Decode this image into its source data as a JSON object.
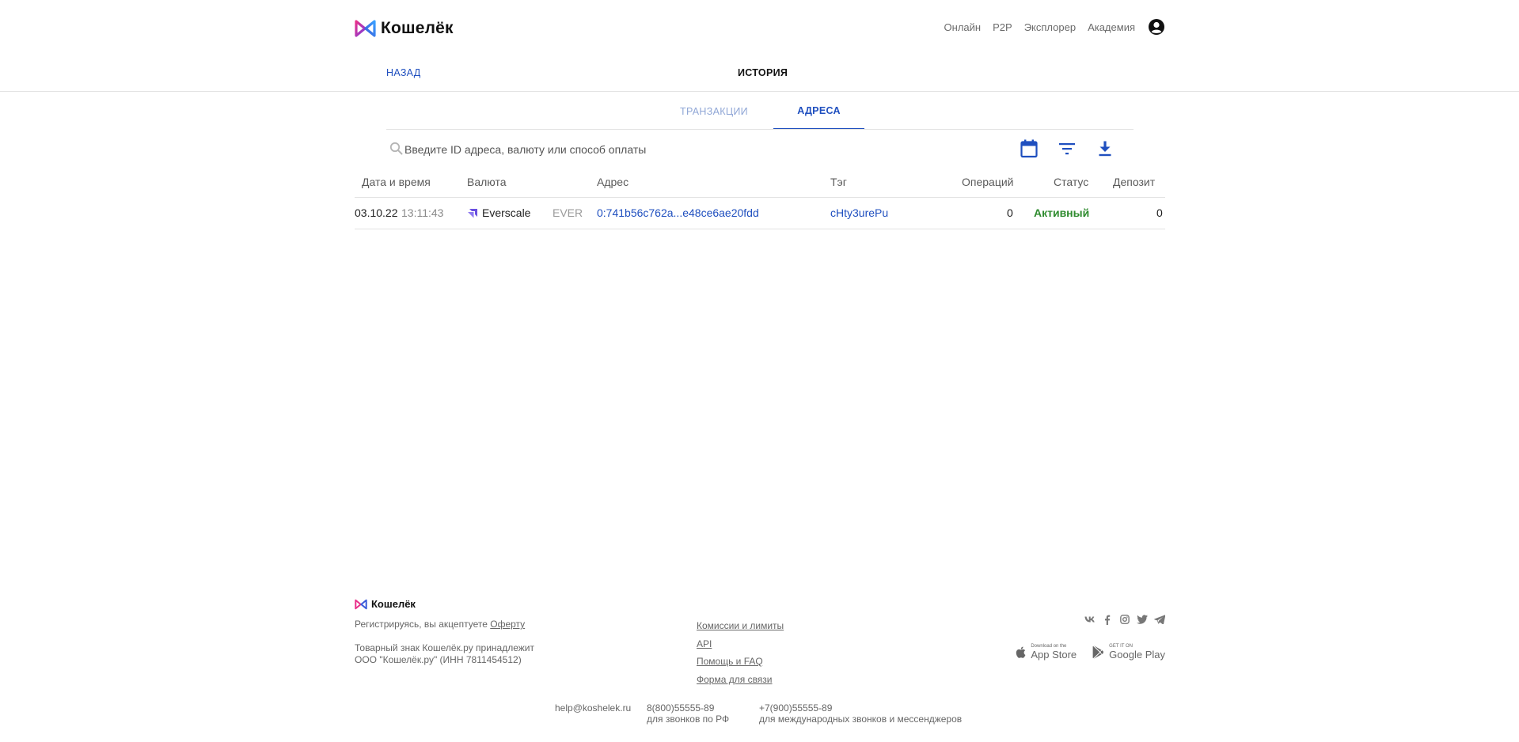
{
  "header": {
    "logo_text": "Кошелёк",
    "nav": [
      "Онлайн",
      "P2P",
      "Эксплорер",
      "Академия"
    ]
  },
  "subbar": {
    "back_label": "НАЗАД",
    "title": "ИСТОРИЯ"
  },
  "tabs": [
    {
      "label": "ТРАНЗАКЦИИ",
      "active": false
    },
    {
      "label": "АДРЕСА",
      "active": true
    }
  ],
  "search": {
    "placeholder": "Введите ID адреса, валюту или способ оплаты",
    "value": ""
  },
  "table": {
    "columns": [
      "Дата и время",
      "Валюта",
      "Адрес",
      "Тэг",
      "Операций",
      "Статус",
      "Депозит"
    ],
    "rows": [
      {
        "date": "03.10.22",
        "time": "13:11:43",
        "currency_name": "Everscale",
        "currency_code": "EVER",
        "address": "0:741b56c762a...e48ce6ae20fdd",
        "tag": "cHty3urePu",
        "operations": "0",
        "status": "Активный",
        "deposit": "0"
      }
    ]
  },
  "footer": {
    "logo_text": "Кошелёк",
    "offer_prefix": "Регистрируясь, вы акцептуете",
    "offer_link": "Оферту",
    "trademark_line1": "Товарный знак Кошелёк.ру принадлежит",
    "trademark_line2": "ООО \"Кошелёк.ру\" (ИНН 7811454512)",
    "links": [
      "Комиссии и лимиты",
      "API",
      "Помощь и FAQ",
      "Форма для связи"
    ],
    "app_store_small": "Download on the",
    "app_store_big": "App Store",
    "google_play_small": "GET IT ON",
    "google_play_big": "Google Play",
    "email": "help@koshelek.ru",
    "phone_ru": "8(800)55555-89",
    "phone_ru_note": "для звонков по РФ",
    "phone_intl": "+7(900)55555-89",
    "phone_intl_note": "для международных звонков и мессенджеров"
  },
  "colors": {
    "accent": "#1f4fbf",
    "status_active": "#2e8b2e",
    "logo_pink": "#e8318a",
    "logo_blue": "#3a5bd9"
  }
}
